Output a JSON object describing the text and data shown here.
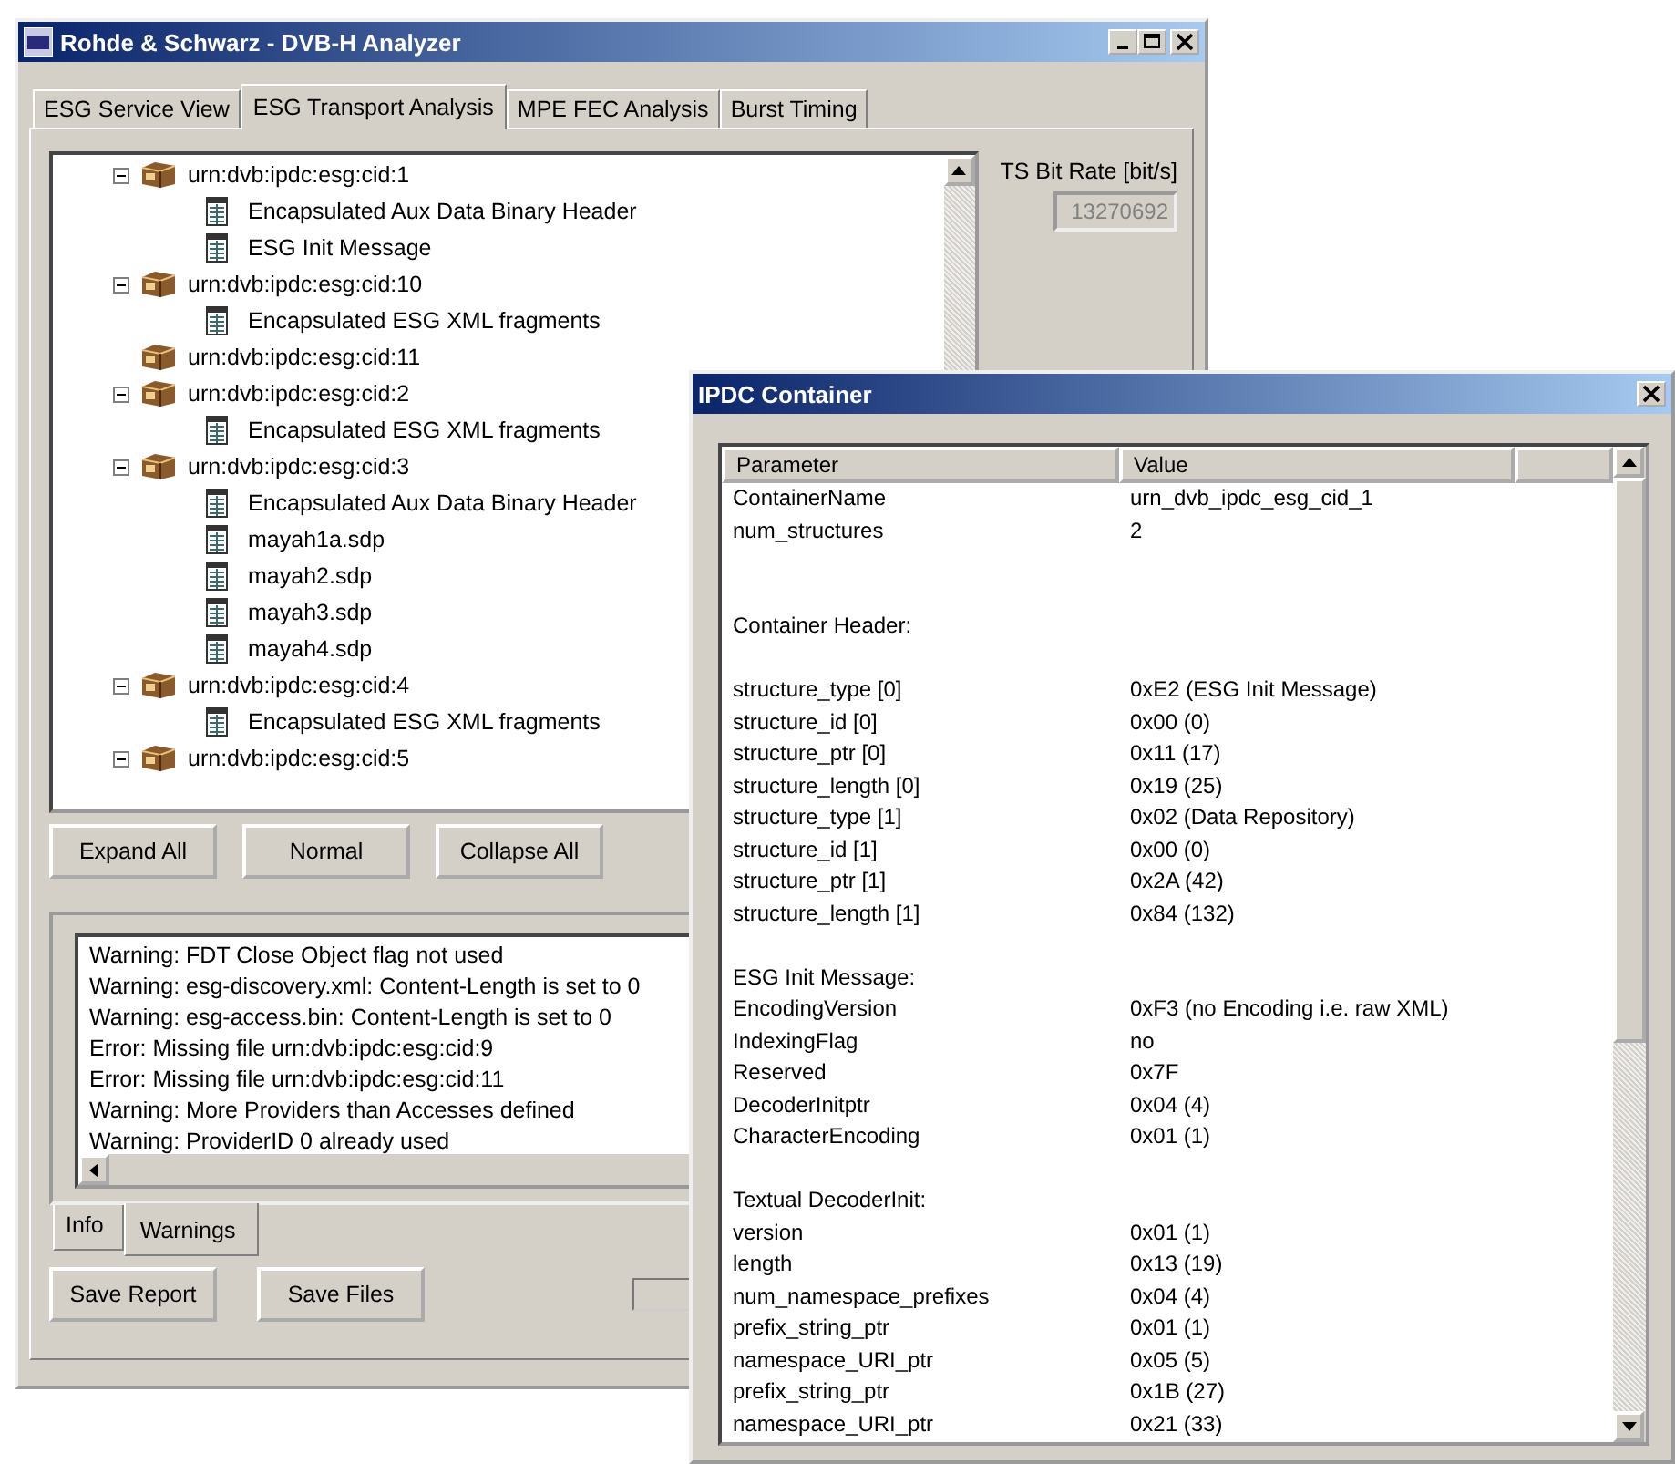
{
  "main_window": {
    "title": "Rohde & Schwarz - DVB-H  Analyzer",
    "tabs": [
      {
        "label": "ESG Service View",
        "selected": false
      },
      {
        "label": "ESG Transport Analysis",
        "selected": true
      },
      {
        "label": "MPE FEC Analysis",
        "selected": false
      },
      {
        "label": "Burst Timing",
        "selected": false
      }
    ],
    "tree": [
      {
        "label": "urn:dvb:ipdc:esg:cid:1",
        "expanded": true,
        "children": [
          {
            "label": "Encapsulated Aux Data Binary Header"
          },
          {
            "label": "ESG Init Message"
          }
        ]
      },
      {
        "label": "urn:dvb:ipdc:esg:cid:10",
        "expanded": true,
        "children": [
          {
            "label": "Encapsulated ESG XML fragments"
          }
        ]
      },
      {
        "label": "urn:dvb:ipdc:esg:cid:11"
      },
      {
        "label": "urn:dvb:ipdc:esg:cid:2",
        "expanded": true,
        "children": [
          {
            "label": "Encapsulated ESG XML fragments"
          }
        ]
      },
      {
        "label": "urn:dvb:ipdc:esg:cid:3",
        "expanded": true,
        "children": [
          {
            "label": "Encapsulated Aux Data Binary Header"
          },
          {
            "label": "mayah1a.sdp"
          },
          {
            "label": "mayah2.sdp"
          },
          {
            "label": "mayah3.sdp"
          },
          {
            "label": "mayah4.sdp"
          }
        ]
      },
      {
        "label": "urn:dvb:ipdc:esg:cid:4",
        "expanded": true,
        "children": [
          {
            "label": "Encapsulated ESG XML fragments"
          }
        ]
      },
      {
        "label": "urn:dvb:ipdc:esg:cid:5",
        "expanded": true
      }
    ],
    "tree_buttons": [
      "Expand All",
      "Normal",
      "Collapse All"
    ],
    "bitrate": {
      "label": "TS Bit Rate [bit/s]",
      "value": "13270692"
    },
    "log": [
      "Warning: FDT Close Object flag not used",
      "Warning: esg-discovery.xml: Content-Length is set to 0",
      "Warning: esg-access.bin: Content-Length is set to 0",
      "Error: Missing file urn:dvb:ipdc:esg:cid:9",
      "Error: Missing file urn:dvb:ipdc:esg:cid:11",
      "Warning: More Providers than Accesses defined",
      "Warning: ProviderID 0 already used"
    ],
    "log_tabs": [
      {
        "label": "Info",
        "selected": false
      },
      {
        "label": "Warnings",
        "selected": true
      }
    ],
    "bottom_buttons": [
      "Save Report",
      "Save Files"
    ]
  },
  "dialog": {
    "title": "IPDC Container",
    "columns": [
      "Parameter",
      "Value"
    ],
    "rows": [
      {
        "kind": "pair",
        "parameter": "ContainerName",
        "value": "urn_dvb_ipdc_esg_cid_1"
      },
      {
        "kind": "pair",
        "parameter": "num_structures",
        "value": "2"
      },
      {
        "kind": "blank"
      },
      {
        "kind": "blank"
      },
      {
        "kind": "heading",
        "parameter": "Container Header:"
      },
      {
        "kind": "blank"
      },
      {
        "kind": "pair",
        "parameter": "structure_type [0]",
        "value": "0xE2 (ESG Init Message)"
      },
      {
        "kind": "pair",
        "parameter": "structure_id [0]",
        "value": "0x00 (0)"
      },
      {
        "kind": "pair",
        "parameter": "structure_ptr [0]",
        "value": "0x11 (17)"
      },
      {
        "kind": "pair",
        "parameter": "structure_length [0]",
        "value": "0x19 (25)"
      },
      {
        "kind": "pair",
        "parameter": "structure_type [1]",
        "value": "0x02 (Data Repository)"
      },
      {
        "kind": "pair",
        "parameter": "structure_id [1]",
        "value": "0x00 (0)"
      },
      {
        "kind": "pair",
        "parameter": "structure_ptr [1]",
        "value": "0x2A (42)"
      },
      {
        "kind": "pair",
        "parameter": "structure_length [1]",
        "value": "0x84 (132)"
      },
      {
        "kind": "blank"
      },
      {
        "kind": "heading",
        "parameter": "ESG Init Message:"
      },
      {
        "kind": "pair",
        "parameter": "EncodingVersion",
        "value": "0xF3 (no Encoding i.e. raw XML)"
      },
      {
        "kind": "pair",
        "parameter": "IndexingFlag",
        "value": "no"
      },
      {
        "kind": "pair",
        "parameter": "Reserved",
        "value": "0x7F"
      },
      {
        "kind": "pair",
        "parameter": "DecoderInitptr",
        "value": "0x04 (4)"
      },
      {
        "kind": "pair",
        "parameter": "CharacterEncoding",
        "value": "0x01 (1)"
      },
      {
        "kind": "blank"
      },
      {
        "kind": "heading",
        "parameter": "Textual DecoderInit:"
      },
      {
        "kind": "pair",
        "parameter": "version",
        "value": "0x01 (1)"
      },
      {
        "kind": "pair",
        "parameter": "length",
        "value": "0x13 (19)"
      },
      {
        "kind": "pair",
        "parameter": "num_namespace_prefixes",
        "value": "0x04 (4)"
      },
      {
        "kind": "pair",
        "parameter": "prefix_string_ptr",
        "value": "0x01 (1)"
      },
      {
        "kind": "pair",
        "parameter": "namespace_URI_ptr",
        "value": "0x05 (5)"
      },
      {
        "kind": "pair",
        "parameter": "prefix_string_ptr",
        "value": "0x1B (27)"
      },
      {
        "kind": "pair",
        "parameter": "namespace_URI_ptr",
        "value": "0x21 (33)"
      }
    ]
  }
}
